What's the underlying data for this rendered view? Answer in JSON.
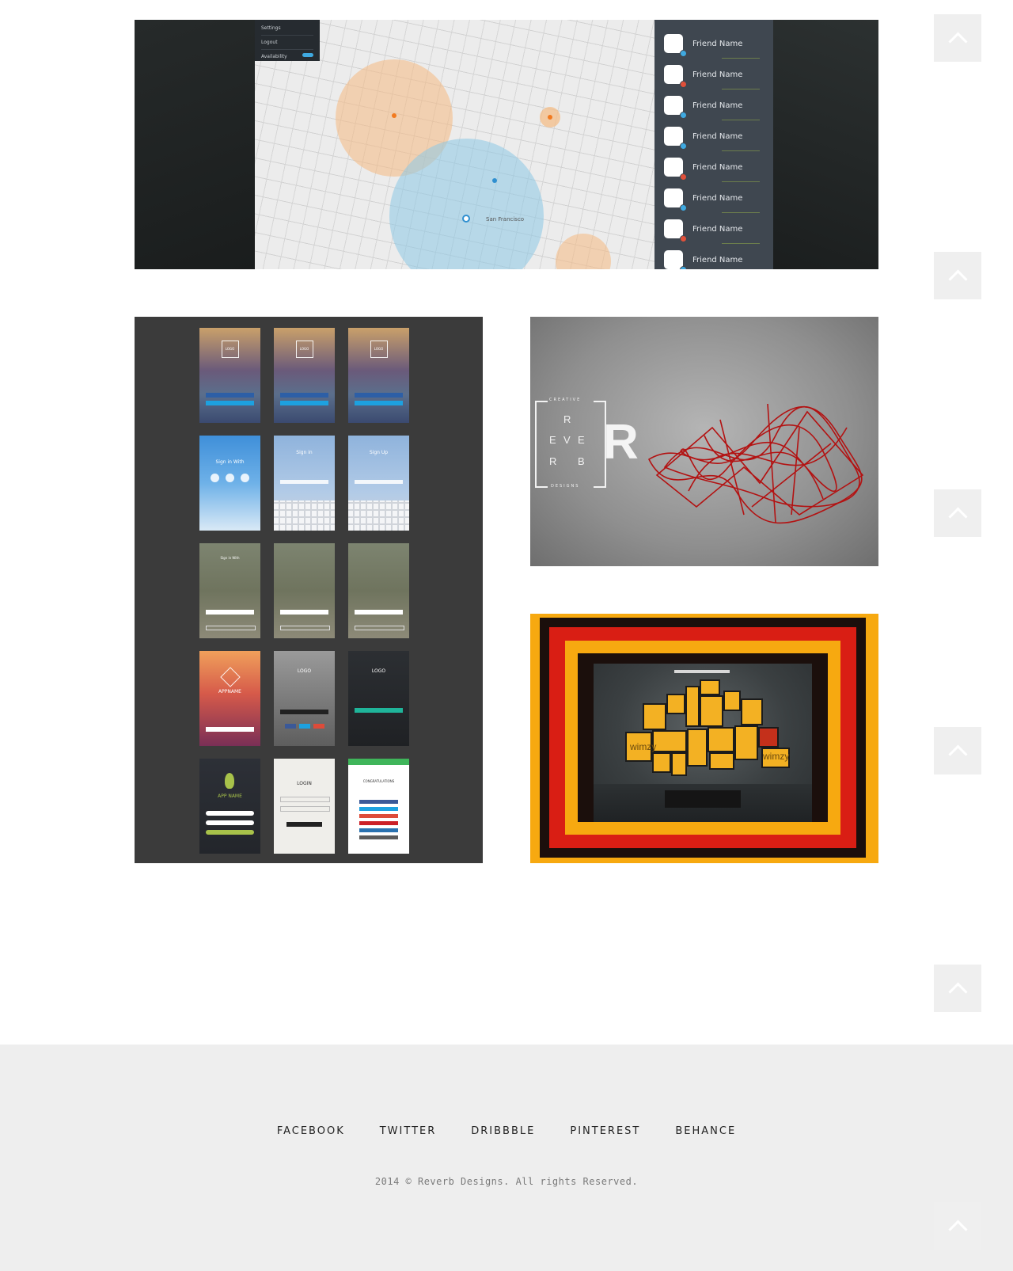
{
  "map_tile": {
    "menu": [
      "Settings",
      "Logout",
      "Availability"
    ],
    "friends": [
      {
        "name": "Friend Name",
        "status_color": "#3fa9e0"
      },
      {
        "name": "Friend Name",
        "status_color": "#e0503a"
      },
      {
        "name": "Friend Name",
        "status_color": "#3fa9e0"
      },
      {
        "name": "Friend Name",
        "status_color": "#3fa9e0"
      },
      {
        "name": "Friend Name",
        "status_color": "#e0503a"
      },
      {
        "name": "Friend Name",
        "status_color": "#3fa9e0"
      },
      {
        "name": "Friend Name",
        "status_color": "#e0503a"
      },
      {
        "name": "Friend Name",
        "status_color": "#3fa9e0"
      }
    ],
    "map_label": "San Francisco"
  },
  "ui_tile": {
    "screens": [
      {
        "title": "",
        "style": "blur-warm",
        "label": "LOGO"
      },
      {
        "title": "",
        "style": "blur-warm",
        "label": "LOGO"
      },
      {
        "title": "",
        "style": "blur-warm",
        "label": "LOGO"
      },
      {
        "title": "Sign in With",
        "style": "sky",
        "label": ""
      },
      {
        "title": "Sign in",
        "style": "keyboard",
        "label": ""
      },
      {
        "title": "Sign Up",
        "style": "keyboard",
        "label": ""
      },
      {
        "title": "Sign in With",
        "style": "beach",
        "label": ""
      },
      {
        "title": "",
        "style": "beach",
        "label": ""
      },
      {
        "title": "",
        "style": "beach",
        "label": ""
      },
      {
        "title": "APPNAME",
        "style": "sunset",
        "label": ""
      },
      {
        "title": "LOGO",
        "style": "grey",
        "label": ""
      },
      {
        "title": "LOGO",
        "style": "dark",
        "label": ""
      },
      {
        "title": "APP NAME",
        "style": "darkgreen",
        "label": ""
      },
      {
        "title": "LOGIN",
        "style": "paper",
        "label": ""
      },
      {
        "title": "CONGRATULATIONS",
        "style": "share",
        "label": ""
      }
    ]
  },
  "reverb_tile": {
    "top_text": "CREATIVE",
    "bottom_text": "DESIGNS",
    "letters": [
      "R",
      "E",
      "V",
      "E",
      "R",
      "B"
    ],
    "big_letter": "R"
  },
  "wimzy_tile": {
    "wall_text": [
      "wimzy",
      "wimzy"
    ]
  },
  "footer": {
    "links": [
      "FACEBOOK",
      "TWITTER",
      "DRIBBBLE",
      "PINTEREST",
      "BEHANCE"
    ],
    "copyright": "2014 © Reverb Designs. All rights Reserved."
  },
  "colors": {
    "footer_bg": "#eeeeee",
    "button_bg": "#efefef",
    "accent_red": "#d91e14",
    "accent_orange": "#f7a910"
  }
}
